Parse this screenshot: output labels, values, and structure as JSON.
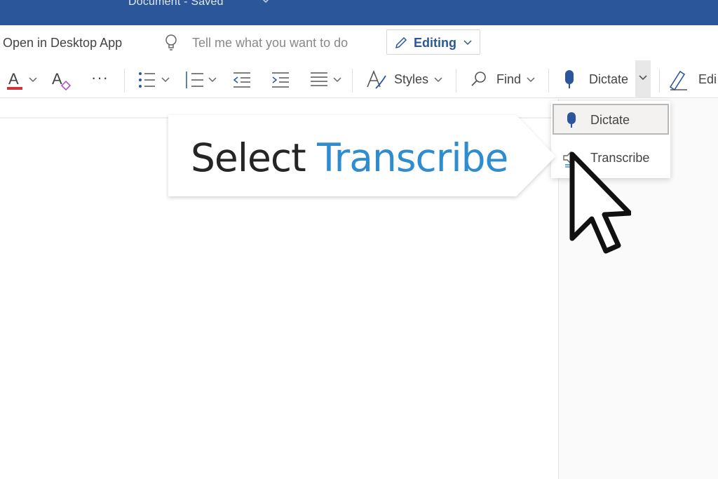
{
  "titlebar": {
    "doc_title": "Document - Saved"
  },
  "commandbar": {
    "open_desktop": "Open in Desktop App",
    "tell_me": "Tell me what you want to do",
    "editing": "Editing"
  },
  "ribbon": {
    "font_color_icon": "font-color-icon",
    "more": "···",
    "styles": "Styles",
    "find": "Find",
    "dictate": "Dictate",
    "editor_partial": "Edi"
  },
  "dropdown": {
    "items": [
      {
        "label": "Dictate",
        "icon": "microphone-icon"
      },
      {
        "label": "Transcribe",
        "icon": "transcribe-icon"
      }
    ]
  },
  "callout": {
    "word1": "Select",
    "word2": "Transcribe"
  },
  "colors": {
    "title_bar": "#2b579a",
    "accent_blue": "#2e8ccf",
    "font_red": "#d13438"
  }
}
